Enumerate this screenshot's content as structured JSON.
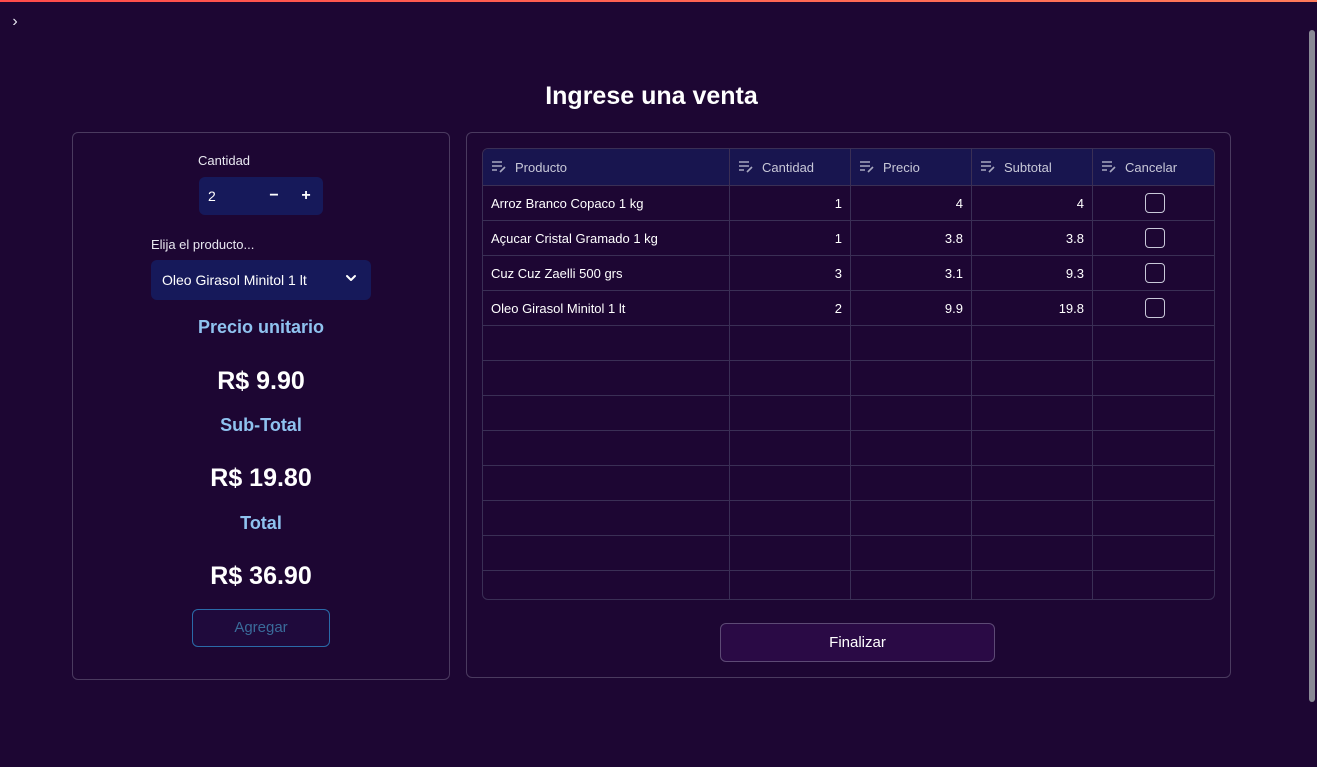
{
  "page": {
    "title": "Ingrese una venta"
  },
  "form": {
    "quantity_label": "Cantidad",
    "quantity_value": "2",
    "minus_label": "−",
    "plus_label": "+",
    "product_label": "Elija el producto...",
    "product_selected": "Oleo Girasol Minitol 1 lt",
    "unit_price_label": "Precio unitario",
    "unit_price_value": "R$ 9.90",
    "subtotal_label": "Sub-Total",
    "subtotal_value": "R$ 19.80",
    "total_label": "Total",
    "total_value": "R$ 36.90",
    "add_button": "Agregar"
  },
  "table": {
    "headers": [
      "Producto",
      "Cantidad",
      "Precio",
      "Subtotal",
      "Cancelar"
    ],
    "rows": [
      {
        "producto": "Arroz Branco Copaco 1 kg",
        "cantidad": "1",
        "precio": "4",
        "subtotal": "4",
        "cancelar": false
      },
      {
        "producto": "Açucar Cristal Gramado 1 kg",
        "cantidad": "1",
        "precio": "3.8",
        "subtotal": "3.8",
        "cancelar": false
      },
      {
        "producto": "Cuz Cuz Zaelli 500 grs",
        "cantidad": "3",
        "precio": "3.1",
        "subtotal": "9.3",
        "cancelar": false
      },
      {
        "producto": "Oleo Girasol Minitol 1 lt",
        "cantidad": "2",
        "precio": "9.9",
        "subtotal": "19.8",
        "cancelar": false
      }
    ],
    "empty_rows": 8
  },
  "finalize_button": "Finalizar",
  "icons": {
    "sidebar_toggle": "chevron-right-icon",
    "select_arrow": "chevron-down-icon",
    "column_menu": "column-sort-icon"
  },
  "colors": {
    "background": "#1d0633",
    "input_bg": "#16195a",
    "heading_blue": "#8fc2ef",
    "accent_line": "#ff4b4b"
  }
}
